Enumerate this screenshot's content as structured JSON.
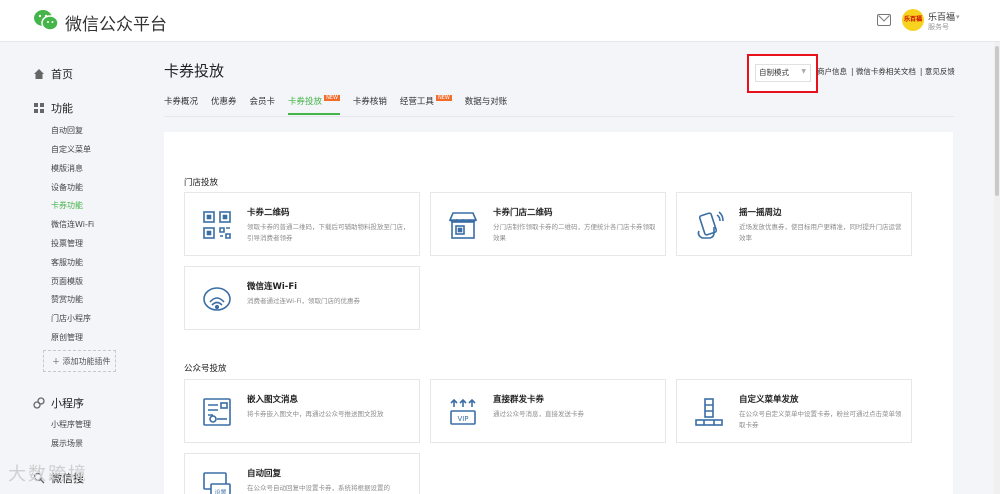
{
  "header": {
    "brand": "微信公众平台",
    "user_name": "乐百福",
    "user_type": "服务号",
    "avatar_text": "乐百福"
  },
  "sidebar": {
    "home": "首页",
    "features": "功能",
    "feature_items": [
      "自动回复",
      "自定义菜单",
      "模版消息",
      "设备功能",
      "卡券功能",
      "微信连Wi-Fi",
      "投票管理",
      "客服功能",
      "页面模版",
      "赞赏功能",
      "门店小程序",
      "原创管理"
    ],
    "add_plugin": "添加功能插件",
    "miniprogram": "小程序",
    "mini_items": [
      "小程序管理",
      "展示场景"
    ],
    "bottom_partial": "微信搜",
    "watermark": "大数跨境"
  },
  "page": {
    "title": "卡券投放",
    "tabs": [
      {
        "label": "卡券概况"
      },
      {
        "label": "优惠券"
      },
      {
        "label": "会员卡"
      },
      {
        "label": "卡券投放",
        "new": "NEW"
      },
      {
        "label": "卡券核销"
      },
      {
        "label": "经营工具",
        "new": "NEW"
      },
      {
        "label": "数据与对账"
      }
    ],
    "mode": "自制模式",
    "links": [
      "商户信息",
      "微信卡券相关文档",
      "意见反馈"
    ]
  },
  "store_section": {
    "title": "门店投放",
    "cards": [
      {
        "title": "卡券二维码",
        "desc": "领取卡券的普通二维码，下载后可辅助物料投放至门店，引导消费者领券",
        "icon": "qrcode-icon"
      },
      {
        "title": "卡券门店二维码",
        "desc": "分门店制作领取卡券的二维码，方便统计各门店卡券领取效果",
        "icon": "store-icon"
      },
      {
        "title": "摇一摇周边",
        "desc": "近场发放优惠券，使目标用户更精准，同时提升门店运营效率",
        "icon": "shake-icon"
      },
      {
        "title": "微信连Wi-Fi",
        "desc": "消费者通过连Wi-Fi，领取门店的优惠券",
        "icon": "wifi-icon"
      }
    ]
  },
  "mp_section": {
    "title": "公众号投放",
    "cards": [
      {
        "title": "嵌入图文消息",
        "desc": "将卡券嵌入图文中，再通过公众号推送图文投放",
        "icon": "article-icon"
      },
      {
        "title": "直接群发卡券",
        "desc": "通过公众号消息，直接发送卡券",
        "icon": "broadcast-icon",
        "icon_text": "VIP"
      },
      {
        "title": "自定义菜单发放",
        "desc": "在公众号自定义菜单中设置卡券，粉丝可通过点击菜单领取卡券",
        "icon": "menu-icon"
      },
      {
        "title": "自动回复",
        "desc": "在公众号自动回复中设置卡券，系统将根据设置的",
        "icon": "autoreply-icon",
        "icon_text": "设置"
      }
    ]
  },
  "colors": {
    "accent": "#44b549",
    "highlight": "#e8101b",
    "badge": "#f36c2c"
  }
}
